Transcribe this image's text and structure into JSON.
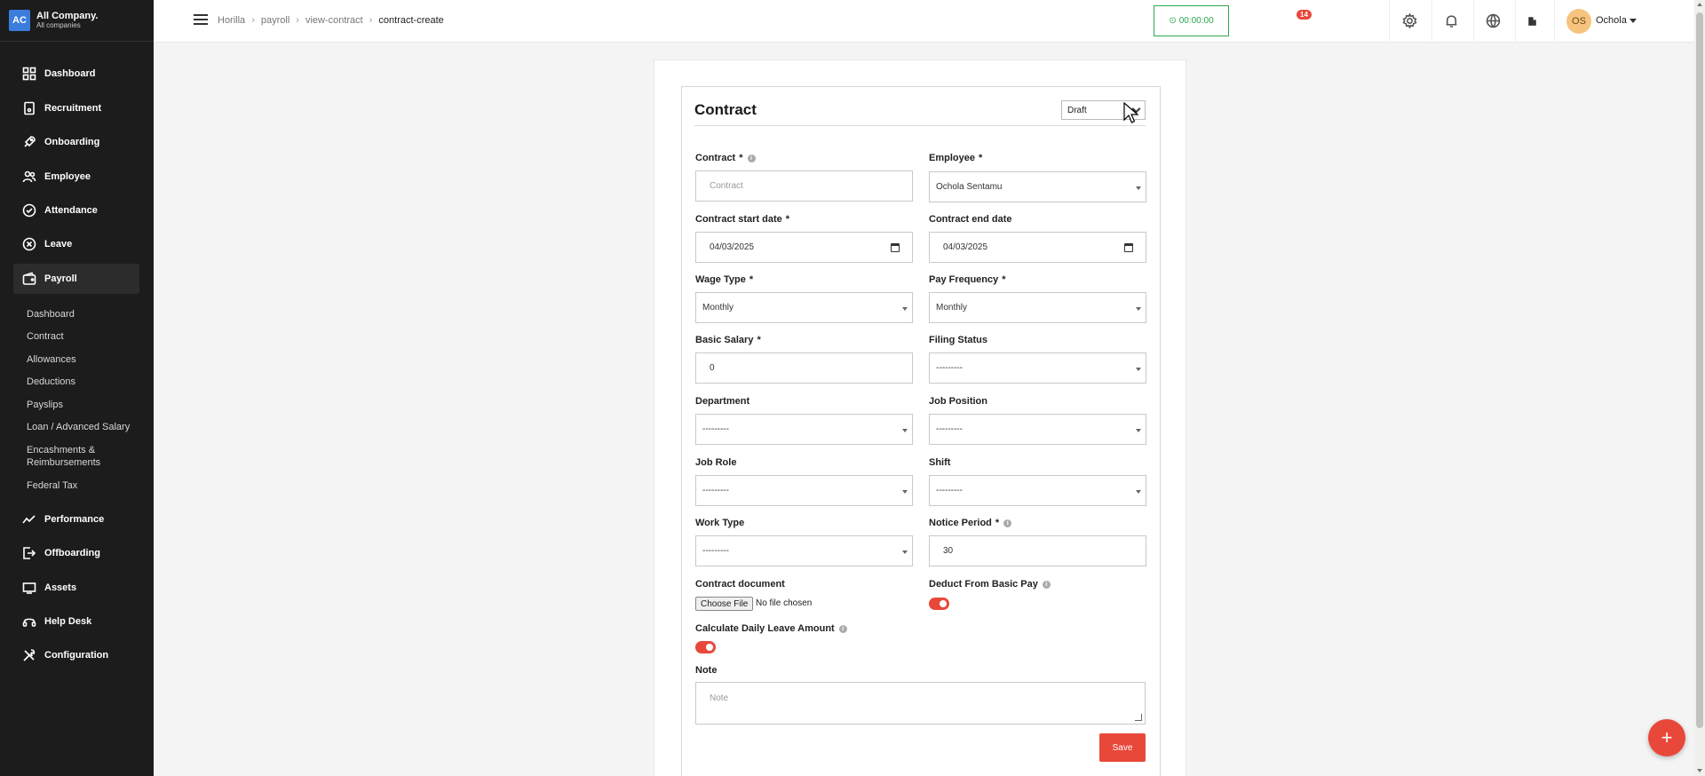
{
  "brand": {
    "logo": "AC",
    "name": "All Company.",
    "sub": "All companies"
  },
  "nav": [
    {
      "label": "Dashboard",
      "icon": "dashboard-icon"
    },
    {
      "label": "Recruitment",
      "icon": "recruitment-icon"
    },
    {
      "label": "Onboarding",
      "icon": "onboarding-icon"
    },
    {
      "label": "Employee",
      "icon": "employee-icon"
    },
    {
      "label": "Attendance",
      "icon": "attendance-icon"
    },
    {
      "label": "Leave",
      "icon": "leave-icon"
    },
    {
      "label": "Payroll",
      "icon": "payroll-icon"
    },
    {
      "label": "Performance",
      "icon": "performance-icon"
    },
    {
      "label": "Offboarding",
      "icon": "offboarding-icon"
    },
    {
      "label": "Assets",
      "icon": "assets-icon"
    },
    {
      "label": "Help Desk",
      "icon": "help-desk-icon"
    },
    {
      "label": "Configuration",
      "icon": "configuration-icon"
    }
  ],
  "payroll_sub": [
    "Dashboard",
    "Contract",
    "Allowances",
    "Deductions",
    "Payslips",
    "Loan / Advanced Salary",
    "Encashments & Reimbursements",
    "Federal Tax"
  ],
  "breadcrumb": [
    "Horilla",
    "payroll",
    "view-contract",
    "contract-create"
  ],
  "header": {
    "timer": "00:00:00",
    "notifications": "14",
    "user_initials": "OS",
    "user_name": "Ochola"
  },
  "form": {
    "title": "Contract",
    "status": "Draft",
    "contract_label": "Contract",
    "contract_placeholder": "Contract",
    "employee_label": "Employee",
    "employee_value": "Ochola Sentamu",
    "start_label": "Contract start date",
    "start_value": "04/03/2025",
    "end_label": "Contract end date",
    "end_value": "04/03/2025",
    "wage_label": "Wage Type",
    "wage_value": "Monthly",
    "freq_label": "Pay Frequency",
    "freq_value": "Monthly",
    "salary_label": "Basic Salary",
    "salary_value": "0",
    "filing_label": "Filing Status",
    "filing_value": "---------",
    "dept_label": "Department",
    "dept_value": "---------",
    "jobpos_label": "Job Position",
    "jobpos_value": "---------",
    "jobrole_label": "Job Role",
    "jobrole_value": "---------",
    "shift_label": "Shift",
    "shift_value": "---------",
    "worktype_label": "Work Type",
    "worktype_value": "---------",
    "notice_label": "Notice Period",
    "notice_value": "30",
    "doc_label": "Contract document",
    "choose_file": "Choose File",
    "no_file": "No file chosen",
    "deduct_label": "Deduct From Basic Pay",
    "deduct_on": true,
    "calc_label": "Calculate Daily Leave Amount",
    "calc_on": true,
    "note_label": "Note",
    "note_placeholder": "Note",
    "required_mark": "*",
    "save_label": "Save"
  },
  "fab_label": "+",
  "colors": {
    "accent": "#e8483a",
    "timer": "#2ca84f",
    "sidebar": "#1c1c1c"
  }
}
